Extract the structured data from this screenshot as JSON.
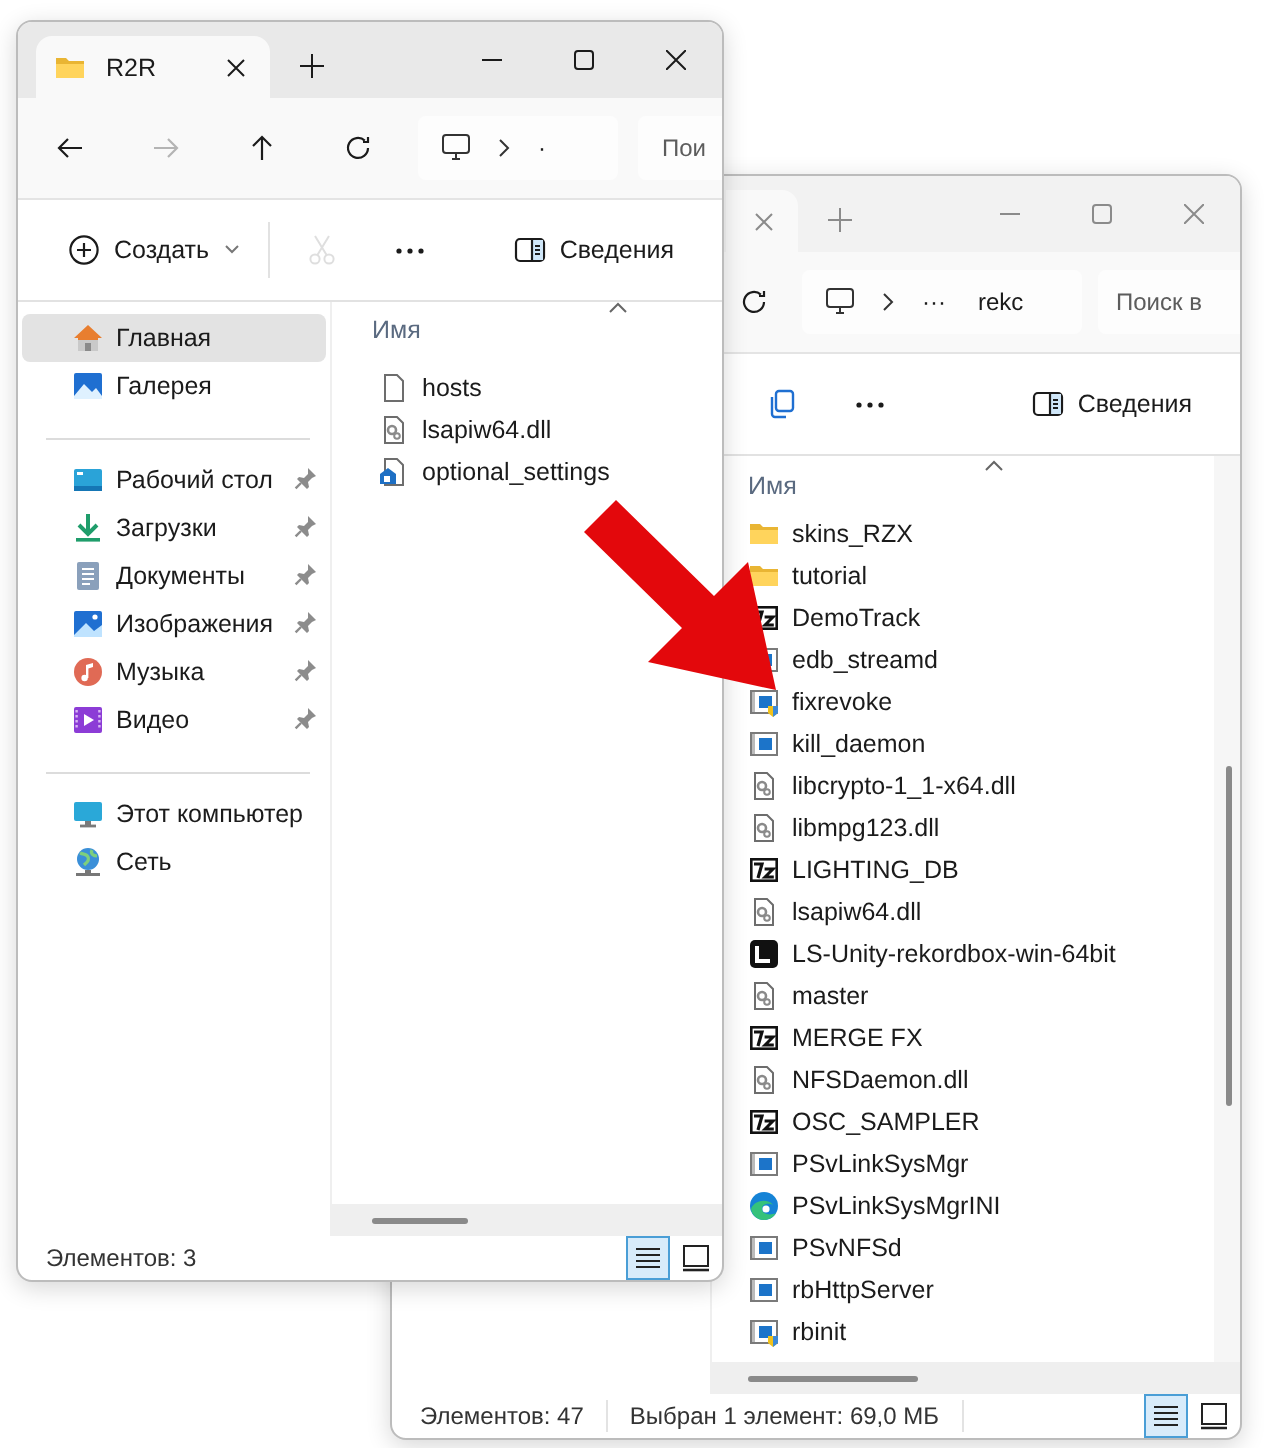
{
  "windows": [
    {
      "active": true,
      "tab": {
        "title": "R2R"
      },
      "nav_buttons": [
        {
          "kind": "back",
          "disabled": false
        },
        {
          "kind": "forward",
          "disabled": true
        },
        {
          "kind": "up",
          "disabled": false
        },
        {
          "kind": "refresh",
          "disabled": false
        }
      ],
      "address": {
        "crumbs": [
          "·"
        ]
      },
      "search": {
        "placeholder": "Пои"
      },
      "toolbar": [
        {
          "kind": "new",
          "label": "Создать",
          "disabled": false
        },
        {
          "kind": "cut",
          "disabled": true
        },
        {
          "kind": "more",
          "disabled": false
        },
        {
          "kind": "details",
          "label": "Сведения",
          "disabled": false
        }
      ],
      "sidebar": {
        "groups": [
          {
            "items": [
              {
                "kind": "home",
                "label": "Главная",
                "pinned": false,
                "selected": true
              },
              {
                "kind": "gallery",
                "label": "Галерея",
                "pinned": false,
                "selected": false
              }
            ]
          },
          {
            "items": [
              {
                "kind": "desktop",
                "label": "Рабочий стол",
                "pinned": true,
                "selected": false
              },
              {
                "kind": "downloads",
                "label": "Загрузки",
                "pinned": true,
                "selected": false
              },
              {
                "kind": "documents",
                "label": "Документы",
                "pinned": true,
                "selected": false
              },
              {
                "kind": "pictures",
                "label": "Изображения",
                "pinned": true,
                "selected": false
              },
              {
                "kind": "music",
                "label": "Музыка",
                "pinned": true,
                "selected": false
              },
              {
                "kind": "video",
                "label": "Видео",
                "pinned": true,
                "selected": false
              }
            ]
          },
          {
            "items": [
              {
                "kind": "computer",
                "label": "Этот компьютер",
                "pinned": false,
                "selected": false
              },
              {
                "kind": "network",
                "label": "Сеть",
                "pinned": false,
                "selected": false
              }
            ]
          }
        ]
      },
      "list": {
        "column": "Имя",
        "files": [
          {
            "name": "hosts",
            "kind": "blank"
          },
          {
            "name": "lsapiw64.dll",
            "kind": "dll"
          },
          {
            "name": "optional_settings",
            "kind": "config"
          }
        ]
      },
      "status_bar": {
        "count": "Элементов: 3"
      },
      "views": [
        {
          "kind": "details",
          "selected": true
        },
        {
          "kind": "tiles",
          "selected": false
        }
      ]
    },
    {
      "active": false,
      "nav_buttons": [
        {
          "kind": "refresh",
          "disabled": false
        }
      ],
      "address": {
        "crumbs": [
          "···",
          "rekc"
        ]
      },
      "search": {
        "placeholder": "Поиск в"
      },
      "toolbar": [
        {
          "kind": "copy",
          "disabled": false
        },
        {
          "kind": "more",
          "disabled": false
        },
        {
          "kind": "details",
          "label": "Сведения",
          "disabled": false
        }
      ],
      "list": {
        "column": "Имя",
        "files": [
          {
            "name": "skins_RZX",
            "kind": "folder"
          },
          {
            "name": "tutorial",
            "kind": "folder"
          },
          {
            "name": "DemoTrack",
            "kind": "archive"
          },
          {
            "name": "edb_streamd",
            "kind": "program"
          },
          {
            "name": "fixrevoke",
            "kind": "program_shield"
          },
          {
            "name": "kill_daemon",
            "kind": "program"
          },
          {
            "name": "libcrypto-1_1-x64.dll",
            "kind": "dll"
          },
          {
            "name": "libmpg123.dll",
            "kind": "dll"
          },
          {
            "name": "LIGHTING_DB",
            "kind": "archive"
          },
          {
            "name": "lsapiw64.dll",
            "kind": "dll"
          },
          {
            "name": "LS-Unity-rekordbox-win-64bit",
            "kind": "app"
          },
          {
            "name": "master",
            "kind": "dll"
          },
          {
            "name": "MERGE FX",
            "kind": "archive"
          },
          {
            "name": "NFSDaemon.dll",
            "kind": "dll"
          },
          {
            "name": "OSC_SAMPLER",
            "kind": "archive"
          },
          {
            "name": "PSvLinkSysMgr",
            "kind": "program"
          },
          {
            "name": "PSvLinkSysMgrINI",
            "kind": "browser"
          },
          {
            "name": "PSvNFSd",
            "kind": "program"
          },
          {
            "name": "rbHttpServer",
            "kind": "program"
          },
          {
            "name": "rbinit",
            "kind": "program_shield"
          }
        ]
      },
      "status_bar": {
        "count": "Элементов: 47",
        "selection": "Выбран 1 элемент: 69,0 МБ"
      },
      "views": [
        {
          "kind": "details",
          "selected": true
        },
        {
          "kind": "tiles",
          "selected": false
        }
      ]
    }
  ]
}
